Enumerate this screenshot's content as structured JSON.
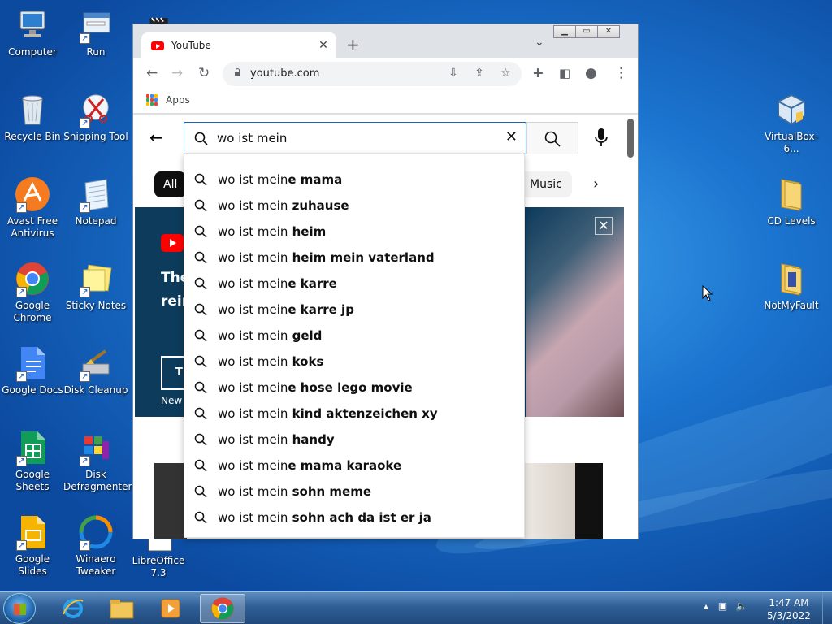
{
  "desktop": {
    "icons": [
      {
        "label": "Computer"
      },
      {
        "label": "Run"
      },
      {
        "label": "Recycle Bin"
      },
      {
        "label": "Snipping Tool"
      },
      {
        "label": "Avast Free Antivirus"
      },
      {
        "label": "Notepad"
      },
      {
        "label": "Google Chrome"
      },
      {
        "label": "Sticky Notes"
      },
      {
        "label": "Google Docs"
      },
      {
        "label": "Disk Cleanup"
      },
      {
        "label": "Google Sheets"
      },
      {
        "label": "Disk Defragmenter"
      },
      {
        "label": "Google Slides"
      },
      {
        "label": "Winaero Tweaker"
      },
      {
        "label": "LibreOffice 7.3"
      },
      {
        "label": "VirtualBox-6..."
      },
      {
        "label": "CD Levels"
      },
      {
        "label": "NotMyFault"
      }
    ]
  },
  "browser": {
    "tab_title": "YouTube",
    "url": "youtube.com",
    "bookmarks_label": "Apps"
  },
  "youtube": {
    "search_query": "wo ist mein",
    "chip_all": "All",
    "chip_music": "Music",
    "banner": {
      "line1": "The",
      "line2": "rein",
      "button": "T",
      "new_text": "New"
    },
    "suggestions": [
      {
        "typed": "wo ist mein",
        "rest": "e mama"
      },
      {
        "typed": "wo ist mein",
        "rest": " zuhause"
      },
      {
        "typed": "wo ist mein",
        "rest": " heim"
      },
      {
        "typed": "wo ist mein",
        "rest": " heim mein vaterland"
      },
      {
        "typed": "wo ist mein",
        "rest": "e karre"
      },
      {
        "typed": "wo ist mein",
        "rest": "e karre jp"
      },
      {
        "typed": "wo ist mein",
        "rest": " geld"
      },
      {
        "typed": "wo ist mein",
        "rest": " koks"
      },
      {
        "typed": "wo ist mein",
        "rest": "e hose lego movie"
      },
      {
        "typed": "wo ist mein",
        "rest": " kind aktenzeichen xy"
      },
      {
        "typed": "wo ist mein",
        "rest": " handy"
      },
      {
        "typed": "wo ist mein",
        "rest": "e mama karaoke"
      },
      {
        "typed": "wo ist mein",
        "rest": " sohn meme"
      },
      {
        "typed": "wo ist mein",
        "rest": " sohn ach da ist er ja"
      }
    ]
  },
  "taskbar": {
    "time": "1:47 AM",
    "date": "5/3/2022"
  },
  "colors": {
    "youtube_red": "#ff0000",
    "search_border": "#1c62b9",
    "desktop_blue": "#1b74cf"
  }
}
